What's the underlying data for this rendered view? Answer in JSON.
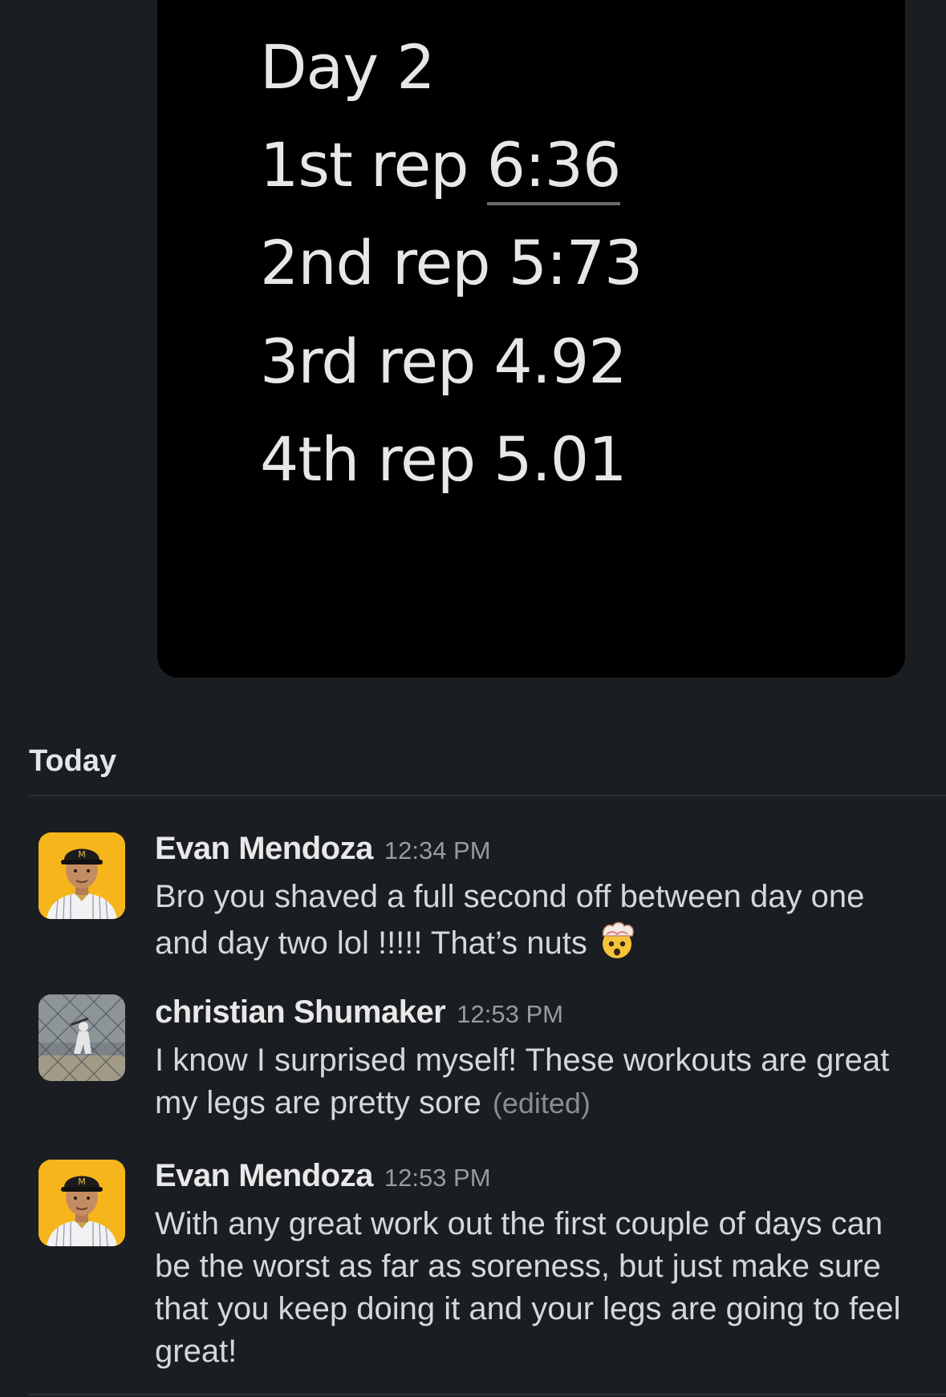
{
  "attachment": {
    "lines": [
      {
        "label": "Day 2",
        "value": ""
      },
      {
        "label": "1st rep",
        "value": "6:36"
      },
      {
        "label": "2nd rep",
        "value": "5:73"
      },
      {
        "label": "3rd rep",
        "value": "4.92"
      },
      {
        "label": "4th rep",
        "value": "5.01"
      }
    ]
  },
  "day_divider": {
    "label": "Today"
  },
  "messages": [
    {
      "sender": "Evan Mendoza",
      "time": "12:34 PM",
      "text": "Bro you shaved a full second off between day one and day two lol !!!!! That’s nuts",
      "emoji": "exploding-head-emoji",
      "avatar": "player-headshot-avatar"
    },
    {
      "sender": "christian Shumaker",
      "time": "12:53 PM",
      "text": "I know I surprised myself! These workouts are great my legs are pretty sore",
      "edited_label": "(edited)",
      "avatar": "baseball-field-photo-avatar"
    },
    {
      "sender": "Evan Mendoza",
      "time": "12:53 PM",
      "text": "With any great work out the first couple of days can be the worst as far as soreness, but just make sure that you keep doing it and your legs are going to feel great!",
      "avatar": "player-headshot-avatar"
    }
  ],
  "colors": {
    "background": "#1a1d21",
    "attachment_bg": "#000000",
    "avatar_evan": "#f6b51a"
  }
}
